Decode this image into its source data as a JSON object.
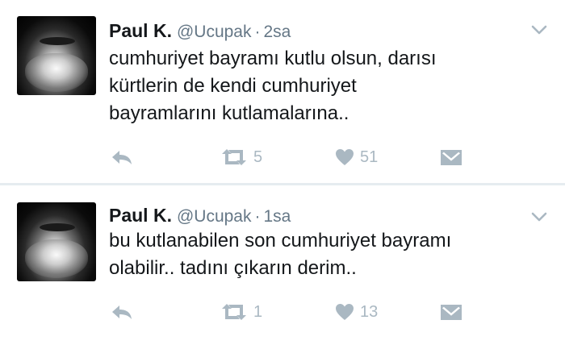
{
  "colors": {
    "text": "#14171a",
    "muted": "#657786",
    "icon": "#aab8c2",
    "divider": "#e6ecf0"
  },
  "tweets": [
    {
      "name": "Paul K.",
      "handle": "@Ucupak",
      "separator": "·",
      "time": "2sa",
      "lines": [
        "cumhuriyet bayramı kutlu olsun, darısı",
        "kürtlerin de kendi cumhuriyet",
        "bayramlarını kutlamalarına.."
      ],
      "retweets": "5",
      "likes": "51",
      "icons": [
        "reply-icon",
        "retweet-icon",
        "like-icon",
        "direct-message-icon",
        "chevron-down-icon"
      ]
    },
    {
      "name": "Paul K.",
      "handle": "@Ucupak",
      "separator": "·",
      "time": "1sa",
      "lines": [
        "bu kutlanabilen son cumhuriyet bayramı",
        "olabilir.. tadını çıkarın derim.."
      ],
      "retweets": "1",
      "likes": "13",
      "icons": [
        "reply-icon",
        "retweet-icon",
        "like-icon",
        "direct-message-icon",
        "chevron-down-icon"
      ]
    }
  ]
}
